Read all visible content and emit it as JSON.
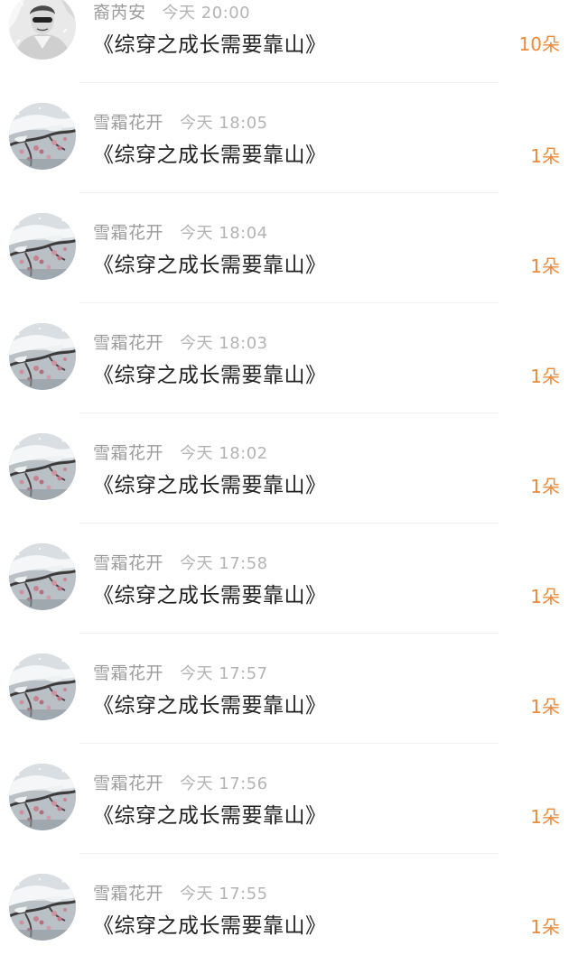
{
  "accent_color": "#ee8a3a",
  "entries": [
    {
      "name": "裔芮安",
      "day": "今天",
      "time": "20:00",
      "title": "《综穿之成长需要靠山》",
      "amount": "10朵",
      "avatar": "person-avatar"
    },
    {
      "name": "雪霜花开",
      "day": "今天",
      "time": "18:05",
      "title": "《综穿之成长需要靠山》",
      "amount": "1朵",
      "avatar": "snow-blossom-avatar"
    },
    {
      "name": "雪霜花开",
      "day": "今天",
      "time": "18:04",
      "title": "《综穿之成长需要靠山》",
      "amount": "1朵",
      "avatar": "snow-blossom-avatar"
    },
    {
      "name": "雪霜花开",
      "day": "今天",
      "time": "18:03",
      "title": "《综穿之成长需要靠山》",
      "amount": "1朵",
      "avatar": "snow-blossom-avatar"
    },
    {
      "name": "雪霜花开",
      "day": "今天",
      "time": "18:02",
      "title": "《综穿之成长需要靠山》",
      "amount": "1朵",
      "avatar": "snow-blossom-avatar"
    },
    {
      "name": "雪霜花开",
      "day": "今天",
      "time": "17:58",
      "title": "《综穿之成长需要靠山》",
      "amount": "1朵",
      "avatar": "snow-blossom-avatar"
    },
    {
      "name": "雪霜花开",
      "day": "今天",
      "time": "17:57",
      "title": "《综穿之成长需要靠山》",
      "amount": "1朵",
      "avatar": "snow-blossom-avatar"
    },
    {
      "name": "雪霜花开",
      "day": "今天",
      "time": "17:56",
      "title": "《综穿之成长需要靠山》",
      "amount": "1朵",
      "avatar": "snow-blossom-avatar"
    },
    {
      "name": "雪霜花开",
      "day": "今天",
      "time": "17:55",
      "title": "《综穿之成长需要靠山》",
      "amount": "1朵",
      "avatar": "snow-blossom-avatar"
    }
  ]
}
